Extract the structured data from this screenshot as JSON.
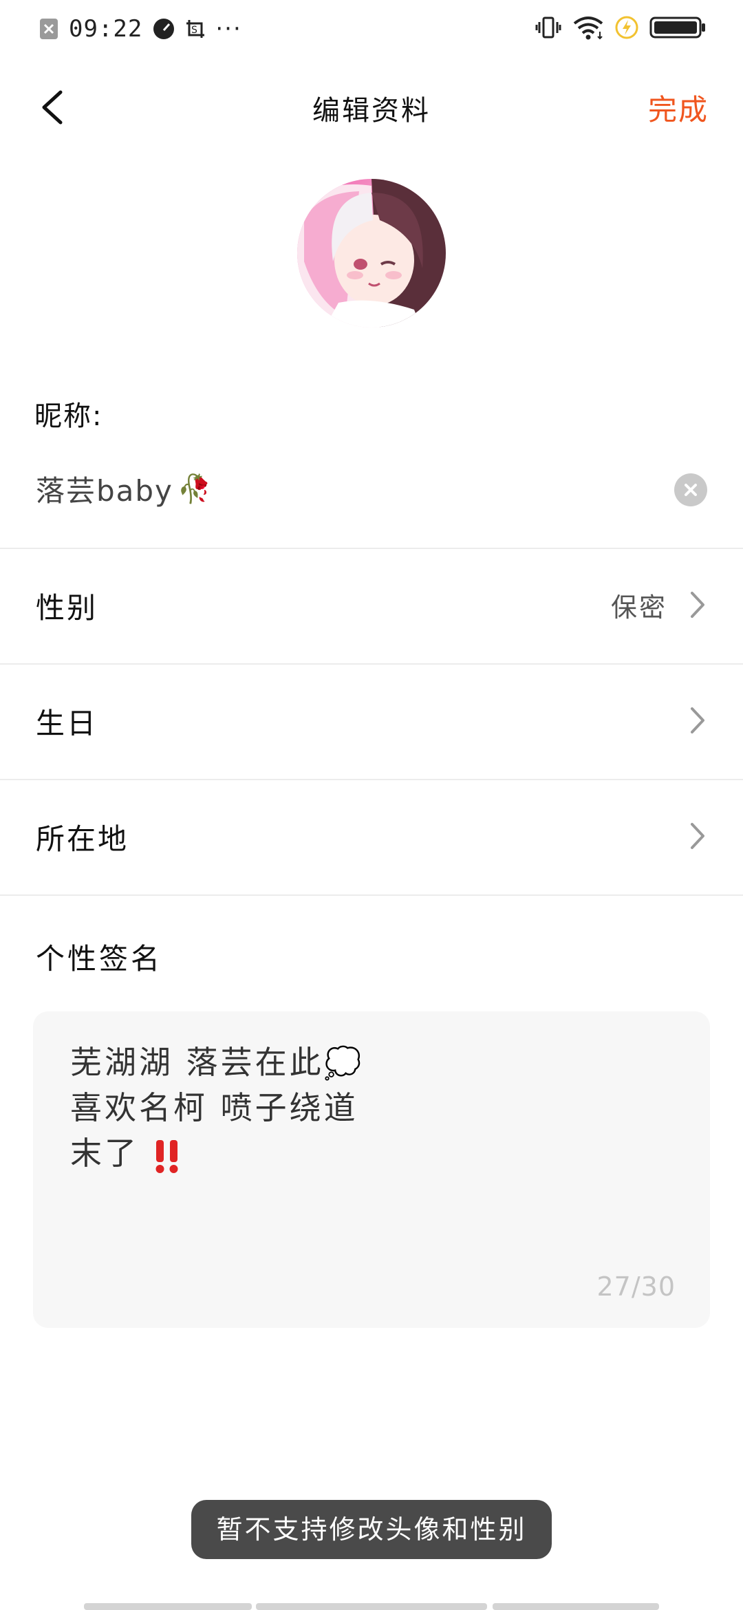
{
  "status_bar": {
    "time": "09:22",
    "more": "···",
    "battery_color": "#222222",
    "charge_color": "#f2c230"
  },
  "header": {
    "title": "编辑资料",
    "done_label": "完成",
    "accent_color": "#f0561f"
  },
  "avatar": {
    "icon": "avatar-image"
  },
  "nickname": {
    "label": "昵称:",
    "value": "落芸baby",
    "emoji": "🥀"
  },
  "rows": [
    {
      "label": "性别",
      "value": "保密"
    },
    {
      "label": "生日",
      "value": ""
    },
    {
      "label": "所在地",
      "value": ""
    }
  ],
  "signature": {
    "label": "个性签名",
    "lines": [
      "芜湖湖 落芸在此",
      "喜欢名柯 喷子绕道",
      "末了"
    ],
    "line1_emoji": "💭",
    "line3_emoji": "‼️",
    "counter": "27/30"
  },
  "toast": {
    "text": "暂不支持修改头像和性别"
  }
}
